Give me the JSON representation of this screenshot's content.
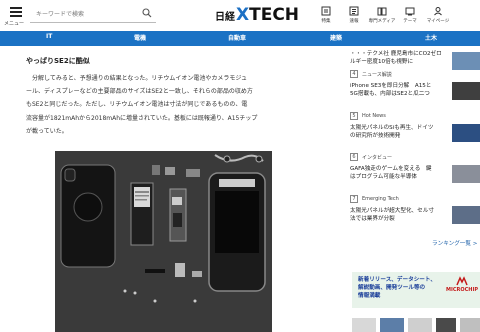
{
  "header": {
    "menu_label": "メニュー",
    "search_placeholder": "キーワードで検索",
    "logo_prefix": "日経",
    "logo_x": "X",
    "logo_rest": "TECH",
    "icons": [
      {
        "name": "special-icon",
        "label": "特集"
      },
      {
        "name": "newsflash-icon",
        "label": "速報"
      },
      {
        "name": "media-icon",
        "label": "専門メディア"
      },
      {
        "name": "theme-icon",
        "label": "テーマ"
      },
      {
        "name": "mypage-icon",
        "label": "マイページ"
      }
    ]
  },
  "nav": {
    "items": [
      "IT",
      "電機",
      "自動車",
      "建築",
      "土木"
    ]
  },
  "article": {
    "subheading": "やっぱりSE2に酷似",
    "paragraph_lines": [
      "　分解してみると、予想通りの結果となった。リチウムイオン電池やカメラモジュ",
      "ール、ディスプレーなどの主要部品のサイズはSE2と一致し、それらの部品の収め方",
      "もSE2と同じだった。ただし、リチウムイオン電池は寸法が同じであるものの、電",
      "流容量が1821mAhから2018mAhに増量されていた。基板には既報通り、A15チップ",
      "が載っていた。"
    ]
  },
  "sidebar": {
    "top_lines": [
      "・・・テクメ社 鹿児島市にCO2ゼロ",
      "ルギー密度10倍も視野に"
    ],
    "items": [
      {
        "tag_number": "4",
        "tag": "ニュース解説",
        "lines": [
          "iPhone SE3を即日分解　A15と",
          "5G搭載も、内部はSE2と瓜二つ"
        ]
      },
      {
        "tag_number": "5",
        "tag": "Hot News",
        "lines": [
          "太陽光パネルのSiも再生、ドイツ",
          "の研究所が技術開発"
        ]
      },
      {
        "tag_number": "6",
        "tag": "インタビュー",
        "lines": [
          "GAFA独走のゲームを変える　鍵",
          "はプログラム可能な半導体"
        ]
      },
      {
        "tag_number": "7",
        "tag": "Emerging Tech",
        "lines": [
          "太陽光パネルが超大型化、セル寸",
          "法では業界が分裂"
        ]
      }
    ],
    "ranking_link": "ランキング一覧 >",
    "ad": {
      "lines": [
        "新着リリース、データシート、",
        "解説動画、開発ツール等の",
        "情報満載"
      ],
      "brand": "MICROCHIP"
    }
  },
  "colors": {
    "nav_bg": "#1b72c4",
    "logo_x": "#1c70c4",
    "link": "#1b5fa8",
    "ad_bg": "#e8f3ea",
    "ad_brand": "#c41a1a"
  }
}
